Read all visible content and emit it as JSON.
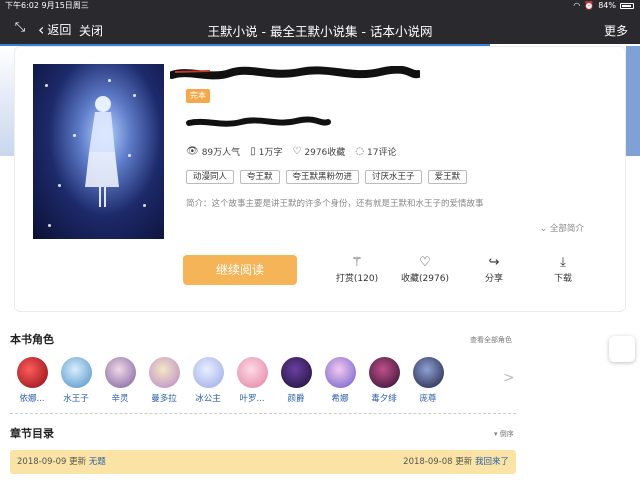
{
  "status_bar": {
    "time": "下午6:02",
    "date": "9月15日周三",
    "battery": "84%"
  },
  "nav": {
    "back_label": "返回",
    "close_label": "关闭",
    "title": "王默小说 - 最全王默小说集 - 话本小说网",
    "more_label": "更多"
  },
  "book": {
    "status_badge": "完本",
    "stats": {
      "popularity": "89万人气",
      "words": "1万字",
      "favorites": "2976收藏",
      "comments": "17评论"
    },
    "tags": [
      "动漫同人",
      "夸王默",
      "夸王默黑粉勿进",
      "讨厌水王子",
      "爱王默"
    ],
    "summary": "简介：这个故事主要是讲王默的许多个身份，还有就是王默和水王子的爱情故事",
    "expand_label": "全部简介"
  },
  "actions": {
    "read_label": "继续阅读",
    "tip_label": "打赏(120)",
    "collect_label": "收藏(2976)",
    "share_label": "分享",
    "download_label": "下载"
  },
  "characters": {
    "title": "本书角色",
    "view_all": "查看全部角色",
    "items": [
      {
        "name": "依娜..."
      },
      {
        "name": "水王子"
      },
      {
        "name": "辛灵"
      },
      {
        "name": "曼多拉"
      },
      {
        "name": "冰公主"
      },
      {
        "name": "叶罗..."
      },
      {
        "name": "颜爵"
      },
      {
        "name": "希娜"
      },
      {
        "name": "毒夕绯"
      },
      {
        "name": "庞尊"
      }
    ]
  },
  "chapters": {
    "title": "章节目录",
    "sort_label": "倒序",
    "first": {
      "date": "2018-09-09",
      "update_word": "更新",
      "name": "无题"
    },
    "last": {
      "date": "2018-09-08",
      "update_word": "更新",
      "name": "我回来了"
    }
  },
  "colors": {
    "accent_orange": "#f5b458",
    "link_blue": "#2a5fa8",
    "nav_dark": "#2a2a2e",
    "chapter_highlight": "#fbe3a6"
  }
}
